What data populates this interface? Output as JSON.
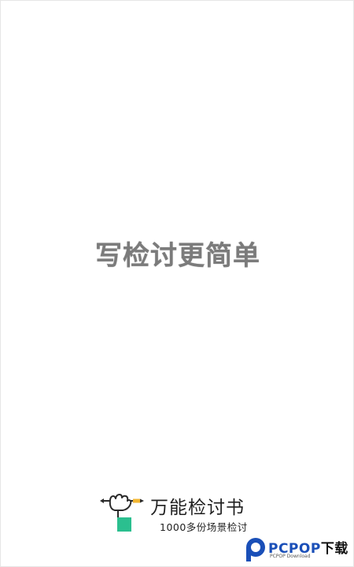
{
  "splash": {
    "slogan": "写检讨更简单"
  },
  "brand": {
    "name": "万能检讨书",
    "tagline": "1000多份场景检讨",
    "logo_icon": "hand-holding-pencil-icon",
    "accent_color": "#2bbf8f"
  },
  "watermark": {
    "brand_latin": "PCPOP",
    "brand_cn": "下载",
    "subtitle": "PCPOP Download",
    "icon": "pcpop-p-logo-icon",
    "color": "#1a4fb8"
  }
}
